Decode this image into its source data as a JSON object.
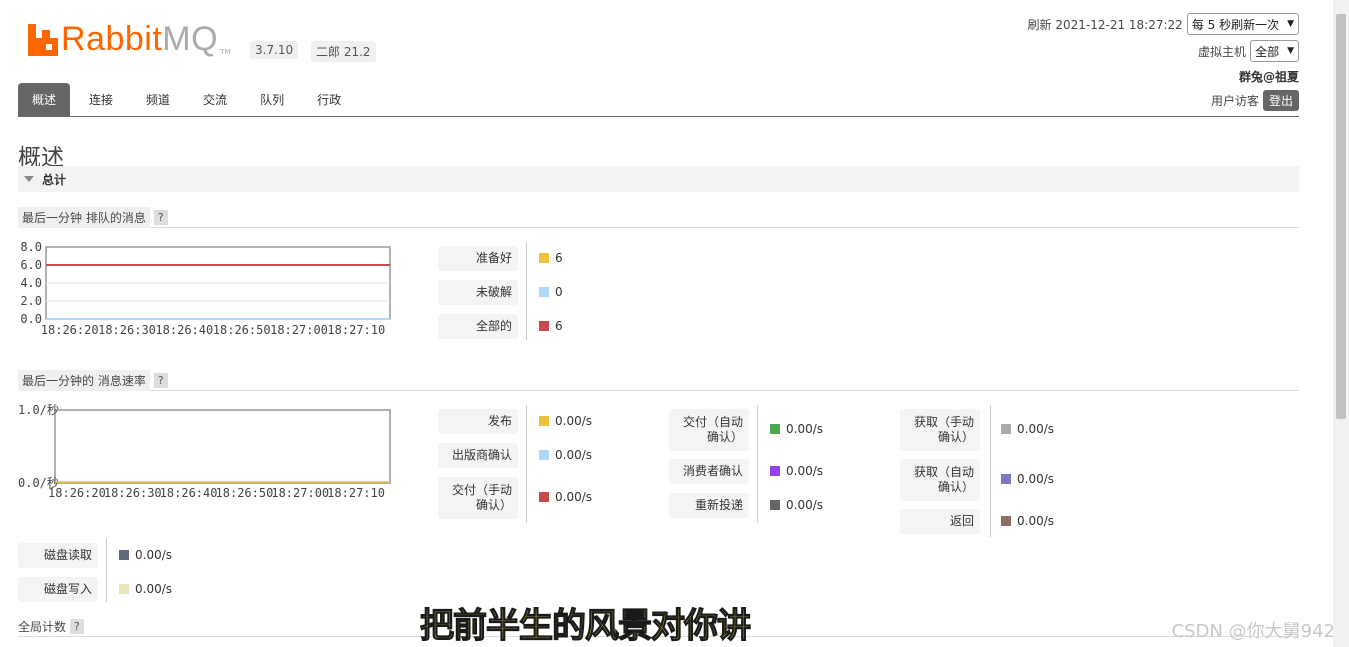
{
  "header": {
    "logo_rabbit": "Rabbit",
    "logo_mq": "MQ",
    "logo_tm": "TM",
    "version_rabbit": "3.7.10",
    "version_erlang": "二郎 21.2",
    "refresh_label": "刷新 2021-12-21 18:27:22",
    "refresh_select": "每 5 秒刷新一次",
    "vhost_label": "虚拟主机",
    "vhost_select": "全部",
    "user_line": "群兔@祖夏",
    "user_label": "用户访客",
    "logout": "登出"
  },
  "nav": {
    "tabs": [
      "概述",
      "连接",
      "频道",
      "交流",
      "队列",
      "行政"
    ],
    "active": 0
  },
  "page": {
    "title": "概述",
    "section": "总计"
  },
  "queued": {
    "header": "最后一分钟 排队的消息",
    "help": "?",
    "legend": [
      {
        "label": "准备好",
        "value": "6",
        "color": "#edc240"
      },
      {
        "label": "未破解",
        "value": "0",
        "color": "#afd8f8"
      },
      {
        "label": "全部的",
        "value": "6",
        "color": "#cb4b4b"
      }
    ]
  },
  "rates": {
    "header": "最后一分钟的 消息速率",
    "help": "?",
    "col1": [
      {
        "label": "发布",
        "value": "0.00/s",
        "color": "#edc240"
      },
      {
        "label": "出版商确认",
        "value": "0.00/s",
        "color": "#afd8f8"
      },
      {
        "label": "交付（手动确认）",
        "value": "0.00/s",
        "color": "#cb4b4b"
      }
    ],
    "col2": [
      {
        "label": "交付（自动确认）",
        "value": "0.00/s",
        "color": "#4da74d"
      },
      {
        "label": "消费者确认",
        "value": "0.00/s",
        "color": "#9440ed"
      },
      {
        "label": "重新投递",
        "value": "0.00/s",
        "color": "#666666"
      }
    ],
    "col3": [
      {
        "label": "获取（手动确认）",
        "value": "0.00/s",
        "color": "#aaaaaa"
      },
      {
        "label": "获取（自动确认）",
        "value": "0.00/s",
        "color": "#7c79c3"
      },
      {
        "label": "返回",
        "value": "0.00/s",
        "color": "#8d6e63"
      }
    ],
    "disk": [
      {
        "label": "磁盘读取",
        "value": "0.00/s",
        "color": "#5f6b7a"
      },
      {
        "label": "磁盘写入",
        "value": "0.00/s",
        "color": "#e6e6b8"
      }
    ]
  },
  "global": {
    "label": "全局计数",
    "help": "?"
  },
  "overlay": {
    "subtitle": "把前半生的风景对你讲",
    "watermark": "CSDN @你大舅942"
  },
  "chart_data": [
    {
      "type": "line",
      "title": "最后一分钟 排队的消息",
      "x": [
        "18:26:20",
        "18:26:30",
        "18:26:40",
        "18:26:50",
        "18:27:00",
        "18:27:10"
      ],
      "yticks": [
        "0.0",
        "2.0",
        "4.0",
        "6.0",
        "8.0"
      ],
      "ylim": [
        0,
        8
      ],
      "grid": true,
      "series": [
        {
          "name": "准备好",
          "values": [
            6,
            6,
            6,
            6,
            6,
            6
          ],
          "color": "#edc240"
        },
        {
          "name": "未破解",
          "values": [
            0,
            0,
            0,
            0,
            0,
            0
          ],
          "color": "#afd8f8"
        },
        {
          "name": "全部的",
          "values": [
            6,
            6,
            6,
            6,
            6,
            6
          ],
          "color": "#cb4b4b"
        }
      ]
    },
    {
      "type": "line",
      "title": "最后一分钟的 消息速率",
      "x": [
        "18:26:20",
        "18:26:30",
        "18:26:40",
        "18:26:50",
        "18:27:00",
        "18:27:10"
      ],
      "yticks": [
        "0.0/秒",
        "1.0/秒"
      ],
      "ylim": [
        0,
        1
      ],
      "grid": false,
      "series": [
        {
          "name": "发布",
          "values": [
            0,
            0,
            0,
            0,
            0,
            0
          ],
          "color": "#edc240"
        }
      ]
    }
  ]
}
